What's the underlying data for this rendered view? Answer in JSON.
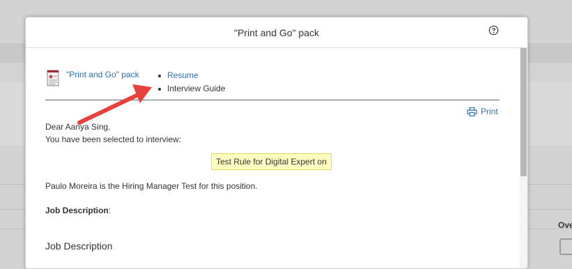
{
  "dialog": {
    "title": "\"Print and Go\" pack",
    "help_icon": "question-circle-icon"
  },
  "pack": {
    "link_label": "\"Print and Go\" pack",
    "icon": "document-icon",
    "documents": [
      {
        "label": "Resume"
      },
      {
        "label": "Interview Guide"
      }
    ]
  },
  "print": {
    "label": "Print",
    "icon": "printer-icon"
  },
  "letter": {
    "greeting": "Dear Aanya Sing,",
    "line1": "You have been selected to interview:",
    "highlight": "Test Rule for Digital Expert on",
    "hiring_manager_line": "Paulo Moreira is the Hiring Manager Test for this position.",
    "job_description_label": "Job Description",
    "job_description_colon": ":",
    "section_heading": "Job Description"
  },
  "background": {
    "right_label": "Ove"
  },
  "colors": {
    "link": "#2a6fb0",
    "arrow": "#e8413c",
    "highlight_bg": "#fffec1"
  }
}
